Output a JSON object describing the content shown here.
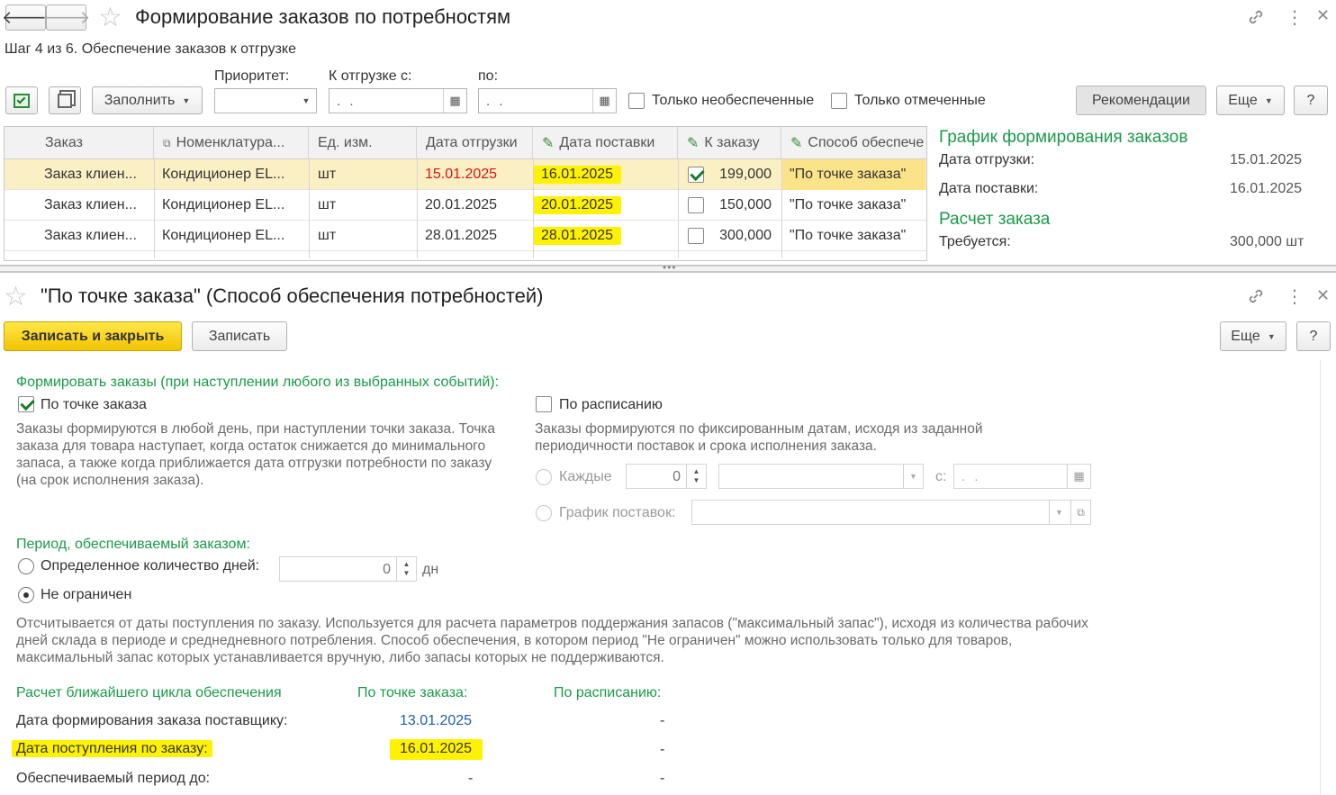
{
  "top": {
    "title": "Формирование заказов по потребностям",
    "subtitle": "Шаг 4 из 6. Обеспечение заказов к отгрузке",
    "fill_button": "Заполнить",
    "priority_label": "Приоритет:",
    "ship_from_label": "К отгрузке с:",
    "to_label": "по:",
    "date_placeholder": ". .",
    "only_unprovided": "Только необеспеченные",
    "only_marked": "Только отмеченные",
    "recommendations_button": "Рекомендации",
    "more_button": "Еще",
    "help_button": "?"
  },
  "table": {
    "columns": [
      "Заказ",
      "Номенклатура...",
      "Ед. изм.",
      "Дата отгрузки",
      "Дата поставки",
      "К заказу",
      "Способ обеспече"
    ],
    "rows": [
      {
        "order": "Заказ клиен...",
        "item": "Кондиционер EL...",
        "unit": "шт",
        "ship_date": "15.01.2025",
        "supply_date": "16.01.2025",
        "checked": true,
        "qty": "199,000",
        "method": "\"По точке заказа\""
      },
      {
        "order": "Заказ клиен...",
        "item": "Кондиционер EL...",
        "unit": "шт",
        "ship_date": "20.01.2025",
        "supply_date": "20.01.2025",
        "checked": false,
        "qty": "150,000",
        "method": "\"По точке заказа\""
      },
      {
        "order": "Заказ клиен...",
        "item": "Кондиционер EL...",
        "unit": "шт",
        "ship_date": "28.01.2025",
        "supply_date": "28.01.2025",
        "checked": false,
        "qty": "300,000",
        "method": "\"По точке заказа\""
      }
    ]
  },
  "side": {
    "schedule_title": "График формирования заказов",
    "ship_date_label": "Дата отгрузки:",
    "ship_date_value": "15.01.2025",
    "supply_date_label": "Дата поставки:",
    "supply_date_value": "16.01.2025",
    "calc_title": "Расчет заказа",
    "required_label": "Требуется:",
    "required_value": "300,000 шт"
  },
  "form": {
    "title": "\"По точке заказа\" (Способ обеспечения потребностей)",
    "save_close_button": "Записать и закрыть",
    "save_button": "Записать",
    "more_button": "Еще",
    "help_button": "?",
    "form_orders_label": "Формировать заказы (при наступлении любого из выбранных событий):",
    "by_point_label": "По точке заказа",
    "by_point_desc": "Заказы формируются в любой день, при наступлении точки заказа. Точка заказа для товара  наступает, когда остаток снижается до минимального запаса, а также когда приближается дата отгрузки потребности по заказу (на срок исполнения заказа).",
    "by_schedule_label": "По расписанию",
    "by_schedule_desc": "Заказы формируются по фиксированным датам, исходя из заданной периодичности поставок и срока исполнения заказа.",
    "each_label": "Каждые",
    "each_value": "0",
    "from_label": "с:",
    "supply_schedule_label": "График поставок:",
    "period_label": "Период, обеспечиваемый заказом:",
    "fixed_days_label": "Определенное количество дней:",
    "days_value": "0",
    "days_unit": "дн",
    "unlimited_label": "Не ограничен",
    "period_desc": "Отсчитывается от даты поступления по заказу. Используется для расчета параметров поддержания запасов (\"максимальный запас\"), исходя из количества рабочих дней склада в периоде и среднедневного потребления. Способ обеспечения, в котором период \"Не ограничен\" можно использовать только для товаров, максимальный запас которых устанавливается вручную, либо запасы которых не поддерживаются.",
    "calc_header": "Расчет ближайшего цикла обеспечения",
    "col_point": "По точке заказа:",
    "col_schedule": "По расписанию:",
    "row1_label": "Дата формирования заказа поставщику:",
    "row1_point": "13.01.2025",
    "row1_sched": "-",
    "row2_label": "Дата поступления по заказу:",
    "row2_point": "16.01.2025",
    "row2_sched": "-",
    "row3_label": "Обеспечиваемый период до:",
    "row3_point": "-",
    "row3_sched": "-"
  }
}
